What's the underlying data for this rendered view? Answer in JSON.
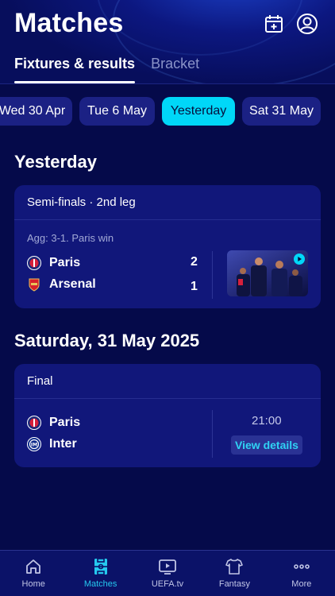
{
  "header": {
    "title": "Matches",
    "tabs": [
      {
        "label": "Fixtures & results",
        "active": true
      },
      {
        "label": "Bracket",
        "active": false
      }
    ]
  },
  "date_chips": [
    {
      "label": "Wed 30 Apr",
      "active": false
    },
    {
      "label": "Tue 6 May",
      "active": false
    },
    {
      "label": "Yesterday",
      "active": true
    },
    {
      "label": "Sat 31 May",
      "active": false
    }
  ],
  "sections": [
    {
      "title": "Yesterday",
      "match": {
        "round": "Semi-finals · 2nd leg",
        "aggregate": "Agg: 3-1. Paris win",
        "home": {
          "name": "Paris",
          "score": "2",
          "crest": "psg-crest-icon"
        },
        "away": {
          "name": "Arsenal",
          "score": "1",
          "crest": "arsenal-crest-icon"
        },
        "thumbnail": "match-highlights-video-thumbnail"
      }
    },
    {
      "title": "Saturday, 31 May 2025",
      "match": {
        "round": "Final",
        "home": {
          "name": "Paris",
          "crest": "psg-crest-icon"
        },
        "away": {
          "name": "Inter",
          "crest": "inter-crest-icon"
        },
        "time": "21:00",
        "details_label": "View details"
      }
    }
  ],
  "bottom_nav": [
    {
      "label": "Home",
      "icon": "home-icon",
      "active": false
    },
    {
      "label": "Matches",
      "icon": "pitch-icon",
      "active": true
    },
    {
      "label": "UEFA.tv",
      "icon": "tv-play-icon",
      "active": false
    },
    {
      "label": "Fantasy",
      "icon": "jersey-icon",
      "active": false
    },
    {
      "label": "More",
      "icon": "more-dots-icon",
      "active": false
    }
  ],
  "colors": {
    "background": "#050a4a",
    "card": "#11177a",
    "accent": "#00d7f8",
    "chip": "#1b2184"
  }
}
